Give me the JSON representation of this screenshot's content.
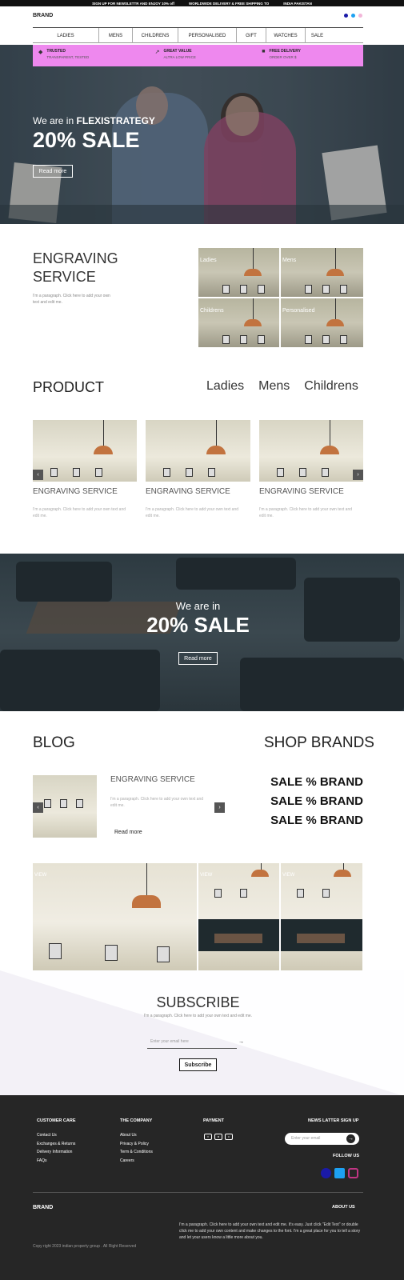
{
  "topbar": {
    "items": [
      "SIGN UP FOR NEWSLETTR AND ENJOY 10% off",
      "WORLDWIDE DELIVERY & FREE SHIPPING TO",
      "INDIA PAKISTAN"
    ]
  },
  "header": {
    "brand": "BRAND"
  },
  "nav": {
    "items": [
      "LADIES",
      "MENS",
      "CHILDRENS",
      "PERSONALISED",
      "GIFT",
      "WATCHES",
      "SALE"
    ]
  },
  "promo": {
    "items": [
      {
        "title": "TRUSTED",
        "sub": "TRANSPARENT, TESTED",
        "icon": "diamond-icon"
      },
      {
        "title": "GREAT VALUE",
        "sub": "ALTRA LOW PRICE",
        "icon": "chart-icon"
      },
      {
        "title": "FREE DELIVERY",
        "sub": "ORDER OVER $",
        "icon": "truck-icon"
      }
    ]
  },
  "hero": {
    "we_are": "We are in",
    "brand_name": "FLEXISTRATEGY",
    "sale": "20% SALE",
    "button": "Read more"
  },
  "engraving": {
    "title": "ENGRAVING SERVICE",
    "para": "I'm a paragraph. Click here to add your own text and edit me.",
    "tiles": [
      "Ladies",
      "Mens",
      "Childrens",
      "Personalised"
    ]
  },
  "product": {
    "title": "PRODUCT",
    "tabs": [
      "Ladies",
      "Mens",
      "Childrens"
    ],
    "cards": [
      {
        "title": "ENGRAVING SERVICE",
        "para": "I'm a paragraph. Click here to add your own text and edit me."
      },
      {
        "title": "ENGRAVING SERVICE",
        "para": "I'm a paragraph. Click here to add your own text and edit me."
      },
      {
        "title": "ENGRAVING SERVICE",
        "para": "I'm a paragraph. Click here to add your own text and edit me."
      }
    ]
  },
  "band": {
    "we_are": "We are in",
    "sale": "20% SALE",
    "button": "Read more"
  },
  "blog": {
    "title": "BLOG",
    "post_title": "ENGRAVING SERVICE",
    "post_para": "I'm a paragraph. Click here to add your own text and edit me.",
    "read_more": "Read more"
  },
  "brands": {
    "title": "SHOP BRANDS",
    "items": [
      "SALE % BRAND",
      "SALE % BRAND",
      "SALE % BRAND"
    ]
  },
  "gallery": {
    "view_label": "VIEW"
  },
  "subscribe": {
    "title": "SUBSCRIBE",
    "para": "I'm a paragraph. Click here to add your own text and edit me.",
    "placeholder": "Enter your email here",
    "button": "Subscribe"
  },
  "footer": {
    "customer_care": {
      "title": "CUSTOMER CARE",
      "links": [
        "Contact Us",
        "Exchanges & Returns",
        "Delivery Information",
        "FAQs"
      ]
    },
    "company": {
      "title": "THE COMPANY",
      "links": [
        "About Us",
        "Privacy & Policy",
        "Term & Conditions",
        "Careers"
      ]
    },
    "payment": {
      "title": "PAYMENT"
    },
    "newsletter": {
      "title": "NEWS LATTER SIGN UP",
      "placeholder": "Enter your email",
      "follow": "FOLLOW US"
    },
    "brand": "BRAND",
    "about_title": "ABOUT US",
    "about_para": "I'm a paragraph. Click here to add your own text and edit me. It's easy. Just click \"Edit Text\" or double click me to add your own content and make changes to the font. I'm a great place for you to tell a story and let your users know a little more about you.",
    "copyright": "Copy right 2023 indian property group . All Right Reserved"
  },
  "colors": {
    "promo": "#ee88ee",
    "footer_bg": "#262626",
    "facebook": "#1a1aa8",
    "twitter": "#1da1f2",
    "instagram": "#c13584"
  }
}
